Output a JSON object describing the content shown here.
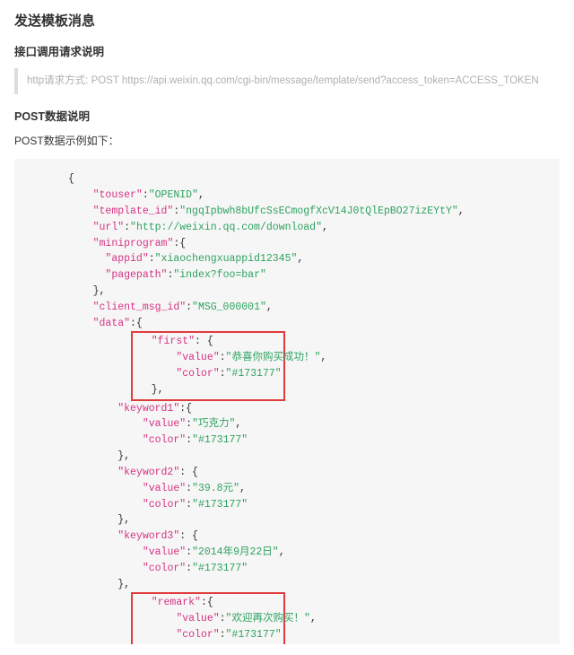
{
  "title": "发送模板消息",
  "section_request_title": "接口调用请求说明",
  "http_line": "http请求方式: POST https://api.weixin.qq.com/cgi-bin/message/template/send?access_token=ACCESS_TOKEN",
  "section_post_title": "POST数据说明",
  "post_example_label": "POST数据示例如下：",
  "json": {
    "touser": "OPENID",
    "template_id": "ngqIpbwh8bUfcSsECmogfXcV14J0tQlEpBO27izEYtY",
    "url": "http://weixin.qq.com/download",
    "miniprogram_key": "miniprogram",
    "appid_key": "appid",
    "appid_val": "xiaochengxuappid12345",
    "pagepath_key": "pagepath",
    "pagepath_val": "index?foo=bar",
    "client_msg_id_key": "client_msg_id",
    "client_msg_id_val": "MSG_000001",
    "data_key": "data",
    "first_key": "first",
    "first_value": "恭喜你购买成功！",
    "first_color": "#173177",
    "keyword1_key": "keyword1",
    "keyword1_value": "巧克力",
    "keyword1_color": "#173177",
    "keyword2_key": "keyword2",
    "keyword2_value": "39.8元",
    "keyword2_color": "#173177",
    "keyword3_key": "keyword3",
    "keyword3_value": "2014年9月22日",
    "keyword3_color": "#173177",
    "remark_key": "remark",
    "remark_value": "欢迎再次购买！",
    "remark_color": "#173177",
    "value_key": "value",
    "color_key": "color"
  }
}
